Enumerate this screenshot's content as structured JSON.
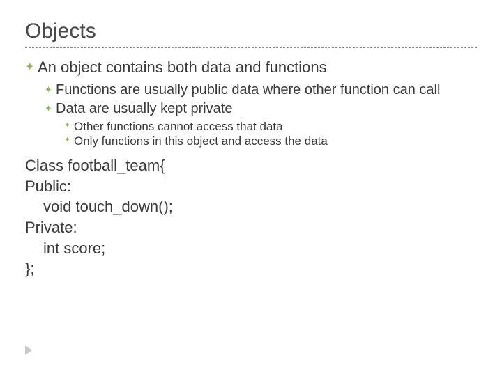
{
  "title": "Objects",
  "bullets": {
    "lvl1": "An object contains both data and functions",
    "lvl2": [
      "Functions are usually public data where other function can call",
      "Data are usually kept private"
    ],
    "lvl3": [
      "Other functions cannot access that data",
      "Only functions in this object and access the data"
    ]
  },
  "code": [
    "Class football_team{",
    "Public:",
    "void touch_down();",
    "Private:",
    "int score;",
    "};"
  ]
}
